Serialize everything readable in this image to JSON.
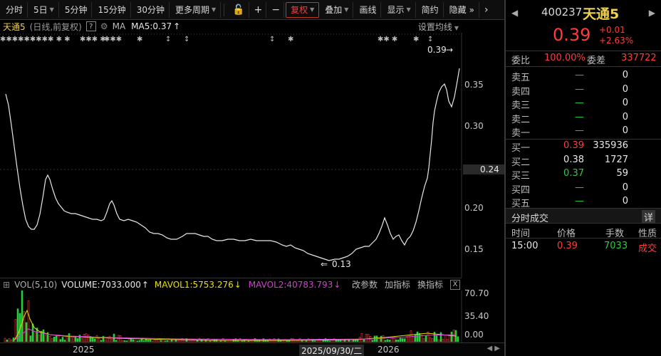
{
  "toolbar": {
    "tabs": [
      "分时",
      "5日",
      "5分钟",
      "15分钟",
      "30分钟",
      "更多周期"
    ],
    "fuquan": "复权",
    "diejia": "叠加",
    "huaxian": "画线",
    "xianshi": "显示",
    "jianyue": "简约",
    "yincang": "隐藏"
  },
  "chart_header": {
    "stock": "天通5",
    "mode": "(日线,前复权)",
    "q": "?",
    "ma": "MA",
    "ma5": "MA5:0.37",
    "setting": "设置均线"
  },
  "price_axis": {
    "ticks": [
      "0.35",
      "0.30",
      "0.24",
      "0.20",
      "0.15"
    ],
    "current": "0.24"
  },
  "annotations": {
    "high": "0.39",
    "low": "0.13"
  },
  "volume": {
    "name": "VOL(5,10)",
    "volume": "VOLUME:7033.000",
    "mavol1": "MAVOL1:5753.276",
    "mavol2": "MAVOL2:40783.793",
    "tools": [
      "改参数",
      "加指标",
      "换指标"
    ],
    "close": "X",
    "axis": [
      "70.70",
      "35.40",
      "0.00"
    ]
  },
  "dates": {
    "y1": "2025",
    "cursor": "2025/09/30/二",
    "y2": "2026"
  },
  "quote": {
    "code": "400237",
    "name": "天通5",
    "price": "0.39",
    "change": "+0.01",
    "change_pct": "+2.63%",
    "webi_label": "委比",
    "webi": "100.00%",
    "weicha_label": "委差",
    "weicha": "337722",
    "asks": [
      {
        "label": "卖五",
        "price": "—",
        "qty": "0"
      },
      {
        "label": "卖四",
        "price": "—",
        "qty": "0"
      },
      {
        "label": "卖三",
        "price": "—",
        "qty": "0"
      },
      {
        "label": "卖二",
        "price": "—",
        "qty": "0"
      },
      {
        "label": "卖一",
        "price": "—",
        "qty": "0"
      }
    ],
    "bids": [
      {
        "label": "买一",
        "price": "0.39",
        "qty": "335936",
        "color": "red"
      },
      {
        "label": "买二",
        "price": "0.38",
        "qty": "1727",
        "color": "white"
      },
      {
        "label": "买三",
        "price": "0.37",
        "qty": "59",
        "color": "green"
      },
      {
        "label": "买四",
        "price": "—",
        "qty": "0",
        "color": "dash"
      },
      {
        "label": "买五",
        "price": "—",
        "qty": "0",
        "color": "dash"
      }
    ]
  },
  "ticks": {
    "title": "分时成交",
    "detail": "详",
    "head": {
      "time": "时间",
      "price": "价格",
      "vol": "手数",
      "nature": "性质"
    },
    "rows": [
      {
        "time": "15:00",
        "price": "0.39",
        "vol": "7033",
        "nature": "成交"
      }
    ]
  },
  "colors": {
    "up": "#ff3b3b",
    "down": "#22d040",
    "name": "#f0d050",
    "mavol1": "#e8e000",
    "mavol2": "#d040d0"
  }
}
